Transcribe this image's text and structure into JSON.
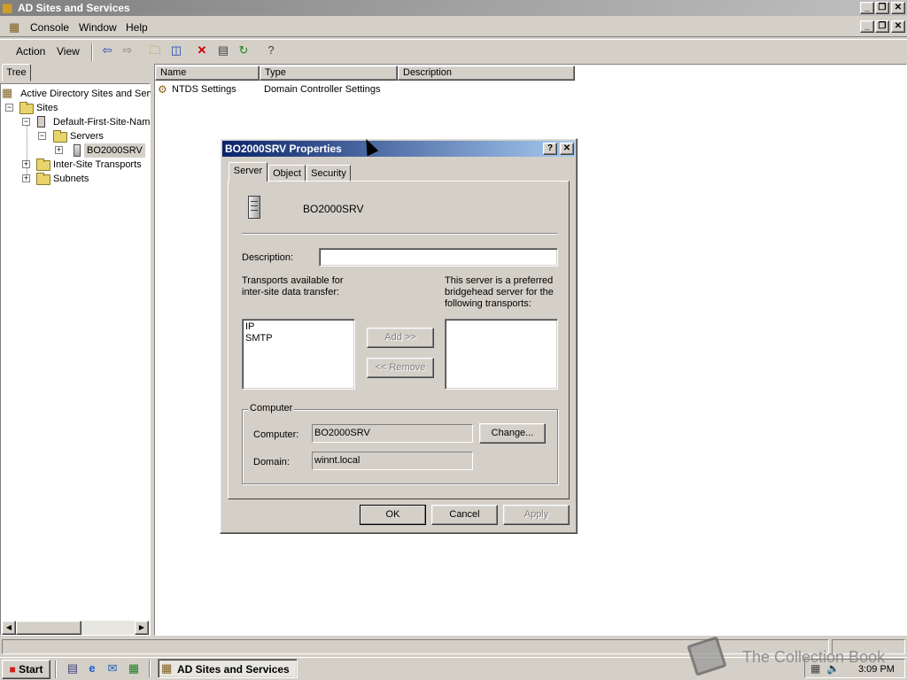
{
  "window": {
    "title": "AD Sites and Services"
  },
  "menubar": {
    "items": [
      "Console",
      "Window",
      "Help"
    ]
  },
  "toolbar": {
    "action_label": "Action",
    "view_label": "View"
  },
  "tree": {
    "tab_label": "Tree",
    "root_label": "Active Directory Sites and Serv",
    "sites_label": "Sites",
    "site_label": "Default-First-Site-Nam",
    "servers_label": "Servers",
    "server_label": "BO2000SRV",
    "transports_label": "Inter-Site Transports",
    "subnets_label": "Subnets"
  },
  "list": {
    "columns": [
      "Name",
      "Type",
      "Description"
    ],
    "rows": [
      {
        "name": "NTDS Settings",
        "type": "Domain Controller Settings",
        "description": ""
      }
    ]
  },
  "dialog": {
    "title": "BO2000SRV Properties",
    "help_button": "?",
    "close_button": "✕",
    "tabs": [
      "Server",
      "Object",
      "Security"
    ],
    "server_name": "BO2000SRV",
    "description_label": "Description:",
    "description_value": "",
    "transports_available_label": "Transports available for inter-site data transfer:",
    "preferred_label": "This server is a preferred bridgehead server for the following transports:",
    "transports_available": [
      "IP",
      "SMTP"
    ],
    "preferred_transports": [],
    "add_button": "Add >>",
    "remove_button": "<< Remove",
    "computer_group_label": "Computer",
    "computer_label": "Computer:",
    "computer_value": "BO2000SRV",
    "change_button": "Change...",
    "domain_label": "Domain:",
    "domain_value": "winnt.local",
    "ok_button": "OK",
    "cancel_button": "Cancel",
    "apply_button": "Apply"
  },
  "taskbar": {
    "start_label": "Start",
    "task_label": "AD Sites and Services",
    "clock": "3:09 PM"
  },
  "watermark": {
    "text": "The Collection Book"
  }
}
